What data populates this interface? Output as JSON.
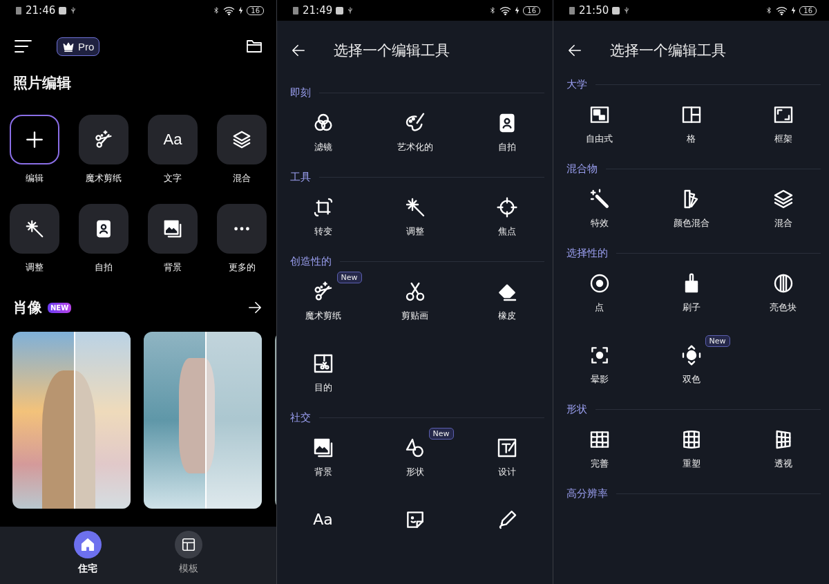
{
  "screens": [
    {
      "kind": "home",
      "status_bar": {
        "time": "21:46",
        "battery": "16"
      },
      "pro_badge": "Pro",
      "title": "照片编辑",
      "tools": [
        {
          "label": "编辑",
          "selected": true
        },
        {
          "label": "魔术剪纸",
          "selected": false
        },
        {
          "label": "文字",
          "glyph": "Aa",
          "selected": false
        },
        {
          "label": "混合",
          "selected": false
        },
        {
          "label": "调整",
          "selected": false
        },
        {
          "label": "自拍",
          "selected": false
        },
        {
          "label": "背景",
          "selected": false
        },
        {
          "label": "更多的",
          "selected": false
        }
      ],
      "portrait": {
        "title": "肖像",
        "badge": "NEW"
      },
      "bottom_nav": [
        {
          "label": "住宅",
          "selected": true
        },
        {
          "label": "模板",
          "selected": false
        }
      ]
    },
    {
      "kind": "tools",
      "status_bar": {
        "time": "21:49",
        "battery": "16"
      },
      "title": "选择一个编辑工具",
      "sections": [
        {
          "title": "即刻",
          "items": [
            {
              "label": "滤镜"
            },
            {
              "label": "艺术化的"
            },
            {
              "label": "自拍"
            }
          ]
        },
        {
          "title": "工具",
          "items": [
            {
              "label": "转变"
            },
            {
              "label": "调整"
            },
            {
              "label": "焦点"
            }
          ]
        },
        {
          "title": "创造性的",
          "items": [
            {
              "label": "魔术剪纸",
              "badge": "New"
            },
            {
              "label": "剪贴画"
            },
            {
              "label": "橡皮"
            },
            {
              "label": "目的"
            }
          ]
        },
        {
          "title": "社交",
          "items": [
            {
              "kind": "tool",
              "label": "背景"
            },
            {
              "kind": "tool",
              "label": "形状",
              "badge": "New"
            },
            {
              "kind": "tool",
              "label": "设计"
            },
            {
              "kind": "glyph",
              "glyph": "Aa"
            },
            {
              "kind": "icon"
            },
            {
              "kind": "icon"
            }
          ]
        }
      ]
    },
    {
      "kind": "tools",
      "status_bar": {
        "time": "21:50",
        "battery": "16"
      },
      "title": "选择一个编辑工具",
      "sections": [
        {
          "title": "大学",
          "items": [
            {
              "label": "自由式"
            },
            {
              "label": "格"
            },
            {
              "label": "框架"
            }
          ]
        },
        {
          "title": "混合物",
          "items": [
            {
              "label": "特效"
            },
            {
              "label": "颜色混合"
            },
            {
              "label": "混合"
            }
          ]
        },
        {
          "title": "选择性的",
          "items": [
            {
              "label": "点"
            },
            {
              "label": "刷子"
            },
            {
              "label": "亮色块"
            },
            {
              "label": "晕影"
            },
            {
              "label": "双色",
              "badge": "New"
            }
          ]
        },
        {
          "title": "形状",
          "items": [
            {
              "label": "完善"
            },
            {
              "label": "重塑"
            },
            {
              "label": "透视"
            }
          ]
        },
        {
          "title": "高分辨率"
        }
      ]
    }
  ]
}
